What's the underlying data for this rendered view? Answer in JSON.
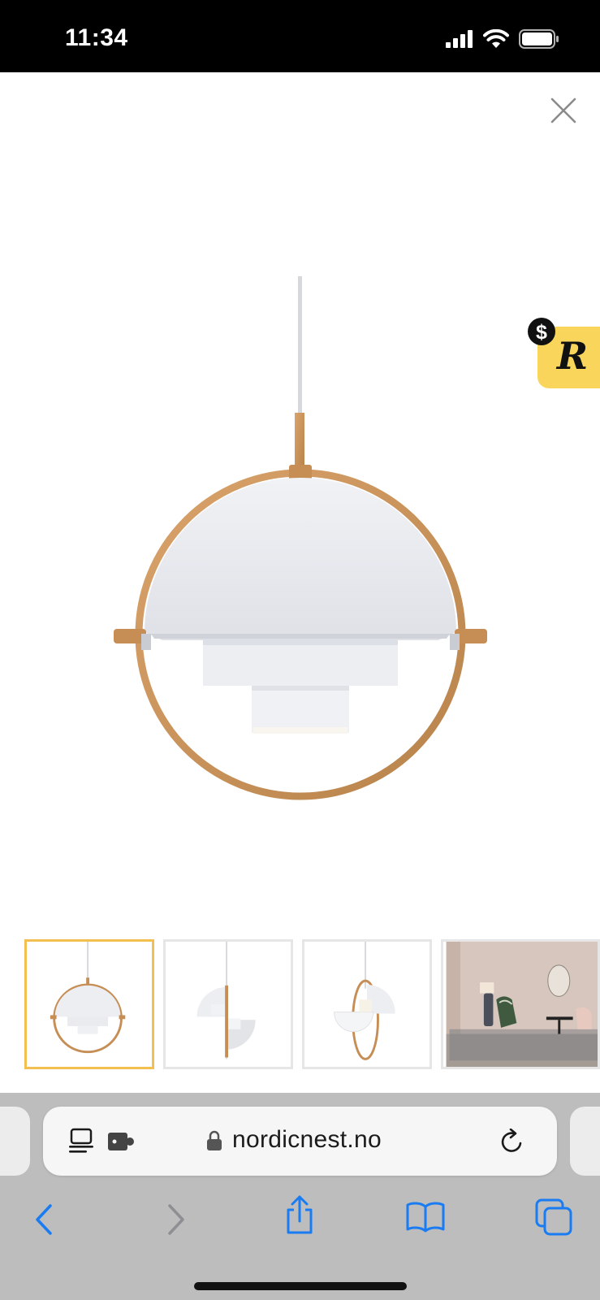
{
  "status_bar": {
    "time": "11:34",
    "icons": [
      "cellular-signal-icon",
      "wifi-icon",
      "battery-icon"
    ]
  },
  "viewer": {
    "close_icon": "close-icon",
    "badge_icon": "dollar-r-badge-icon",
    "badge_color": "#f9d65b",
    "main_image": "pendant-lamp-white-brass",
    "thumbnails": [
      {
        "name": "thumbnail-front",
        "active": true
      },
      {
        "name": "thumbnail-side",
        "active": false
      },
      {
        "name": "thumbnail-open",
        "active": false
      },
      {
        "name": "thumbnail-room",
        "active": false
      }
    ],
    "active_border_color": "#f3c04f"
  },
  "safari": {
    "url": "nordicnest.no",
    "lock_icon": "lock-icon",
    "page_menu_icon": "page-menu-icon",
    "extension_icon": "extension-icon",
    "reload_icon": "reload-icon",
    "toolbar": [
      "back-icon",
      "forward-icon",
      "share-icon",
      "bookmarks-icon",
      "tabs-icon"
    ],
    "accent_color": "#1a7cf2"
  }
}
